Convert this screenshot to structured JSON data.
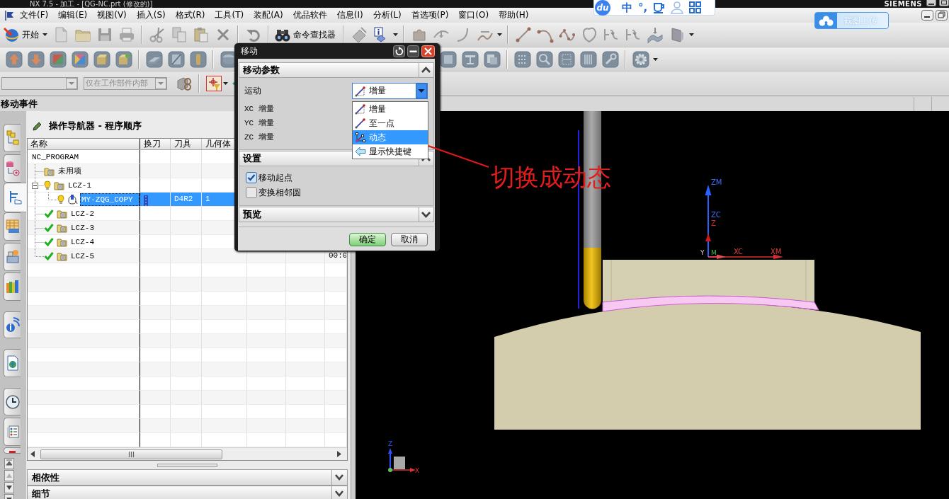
{
  "window": {
    "title": "NX 7.5 - 加工 - [QG-NC.prt (修改的)]",
    "brand": "SIEMENS"
  },
  "ime_toolbar": {
    "logo": "du",
    "mode": "中",
    "punctuation": "°,"
  },
  "cloud_button": {
    "label": "截图上传"
  },
  "menu": [
    "文件(F)",
    "编辑(E)",
    "视图(V)",
    "插入(S)",
    "格式(R)",
    "工具(T)",
    "装配(A)",
    "优品软件",
    "信息(I)",
    "分析(L)",
    "首选项(P)",
    "窗口(O)",
    "帮助(H)"
  ],
  "toolbar": {
    "start_button": "开始",
    "command_finder": "命令查找器"
  },
  "selection_bar": {
    "filters": [
      {
        "disabled": true
      },
      {
        "value": "仅在工作部件内部",
        "disabled": true
      }
    ]
  },
  "cue_line": "移动事件",
  "resource_tabs": [
    {
      "selected": false
    },
    {
      "selected": false
    },
    {
      "selected": true
    },
    {
      "selected": false
    },
    {
      "selected": false
    },
    {
      "selected": false
    },
    {
      "selected": false
    },
    {
      "selected": false
    },
    {
      "selected": false
    },
    {
      "selected": false
    },
    {
      "selected": false
    }
  ],
  "navigator": {
    "title": "操作导航器 - 程序顺序",
    "columns": [
      "名称",
      "换刀",
      "刀具",
      "几何体"
    ],
    "rows": [
      {
        "name": "NC_PROGRAM",
        "needs_regeneration": false,
        "complete": false,
        "selected": false,
        "tool_change": false,
        "children": [
          {
            "name": "未用项",
            "kind": "group",
            "needs_regeneration": false,
            "complete": false,
            "selected": false,
            "tool_change": false
          },
          {
            "name": "LCZ-1",
            "kind": "group",
            "needs_regeneration": true,
            "complete": false,
            "selected": false,
            "tool_change": false,
            "expanded": true,
            "children": [
              {
                "name": "MY-ZQG_COPY",
                "kind": "operation",
                "needs_regeneration": true,
                "complete": false,
                "selected": true,
                "tool_change": true,
                "tool": "D4R2",
                "geometry": "1"
              }
            ]
          },
          {
            "name": "LCZ-2",
            "kind": "group",
            "needs_regeneration": false,
            "complete": true,
            "selected": false,
            "tool_change": false
          },
          {
            "name": "LCZ-3",
            "kind": "group",
            "needs_regeneration": false,
            "complete": true,
            "selected": false,
            "tool_change": false
          },
          {
            "name": "LCZ-4",
            "kind": "group",
            "needs_regeneration": false,
            "complete": true,
            "selected": false,
            "tool_change": false
          },
          {
            "name": "LCZ-5",
            "kind": "group",
            "needs_regeneration": false,
            "complete": true,
            "selected": false,
            "tool_change": false,
            "column_7": "00:0"
          }
        ]
      }
    ],
    "panels": [
      {
        "title": "相依性",
        "expanded": false
      },
      {
        "title": "细节",
        "expanded": false
      }
    ]
  },
  "dialog": {
    "title": "移动",
    "sections": [
      {
        "kind": "motion",
        "title": "移动参数",
        "expanded": true,
        "motion_label": "运动",
        "motion_value": "增量",
        "dropdown_open": true,
        "options": [
          {
            "label": "增量",
            "selected": false
          },
          {
            "label": "至一点",
            "selected": false
          },
          {
            "label": "动态",
            "selected": true
          },
          {
            "label": "显示快捷键",
            "selected": false
          }
        ],
        "increments": [
          "XC 增量",
          "YC 增量",
          "ZC 增量"
        ]
      },
      {
        "kind": "settings",
        "title": "设置",
        "expanded": true,
        "checkboxes": [
          {
            "label": "移动起点",
            "checked": true
          },
          {
            "label": "变换相邻圆",
            "checked": false
          }
        ]
      },
      {
        "kind": "preview",
        "title": "预览",
        "expanded": false
      }
    ],
    "buttons": [
      {
        "label": "确定",
        "kind": "primary"
      },
      {
        "label": "取消",
        "kind": "default"
      }
    ]
  },
  "annotation": {
    "text": "切换成动态"
  },
  "viewport": {
    "axis_labels": [
      "ZM",
      "ZC",
      "Z",
      "Y",
      "M",
      "XC",
      "XM"
    ],
    "triad_labels": [
      "Z",
      "X"
    ]
  }
}
